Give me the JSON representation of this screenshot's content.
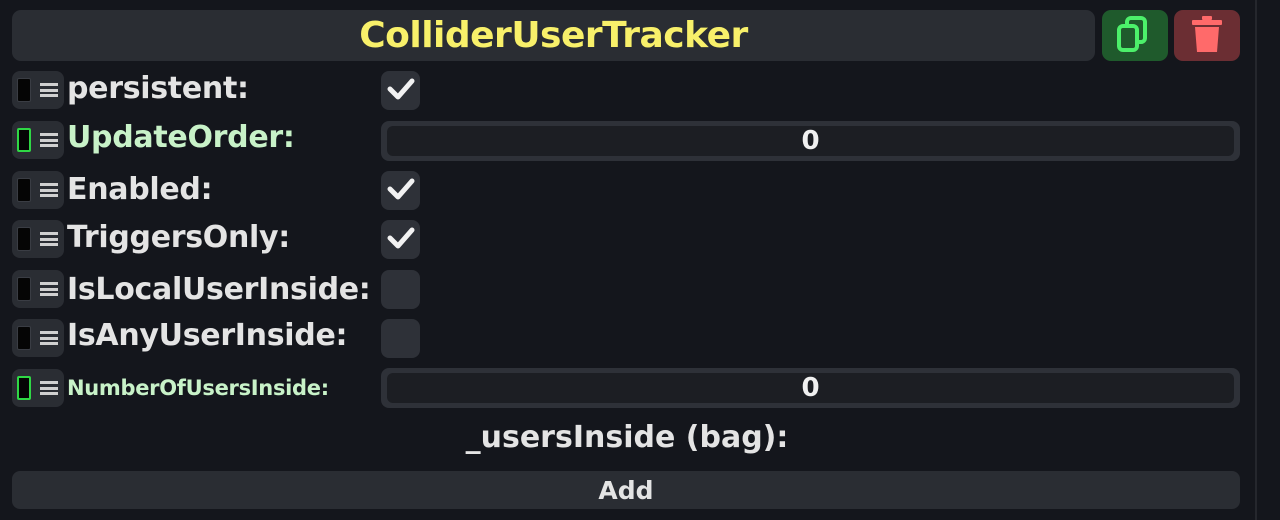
{
  "component": {
    "title": "ColliderUserTracker",
    "title_color": "#f8f06a",
    "duplicate_icon": "duplicate-icon",
    "delete_icon": "trash-icon"
  },
  "fields": {
    "persistent": {
      "label": "persistent:",
      "checked": true
    },
    "update_order": {
      "label": "UpdateOrder:",
      "value": "0"
    },
    "enabled": {
      "label": "Enabled:",
      "checked": true
    },
    "triggers_only": {
      "label": "TriggersOnly:",
      "checked": true
    },
    "is_local_user_inside": {
      "label": "IsLocalUserInside:",
      "checked": false
    },
    "is_any_user_inside": {
      "label": "IsAnyUserInside:",
      "checked": false
    },
    "number_of_users_inside": {
      "label": "NumberOfUsersInside:",
      "value": "0"
    }
  },
  "bag": {
    "title": "_usersInside (bag):",
    "add_label": "Add"
  },
  "colors": {
    "background": "#14161c",
    "panel": "#2a2d33",
    "driven_green": "#2fd845",
    "label_green": "#c8f2c8",
    "duplicate_bg": "#1f5a2c",
    "duplicate_fg": "#4cf06a",
    "delete_bg": "#6b2e33",
    "delete_fg": "#ff6a6a"
  }
}
